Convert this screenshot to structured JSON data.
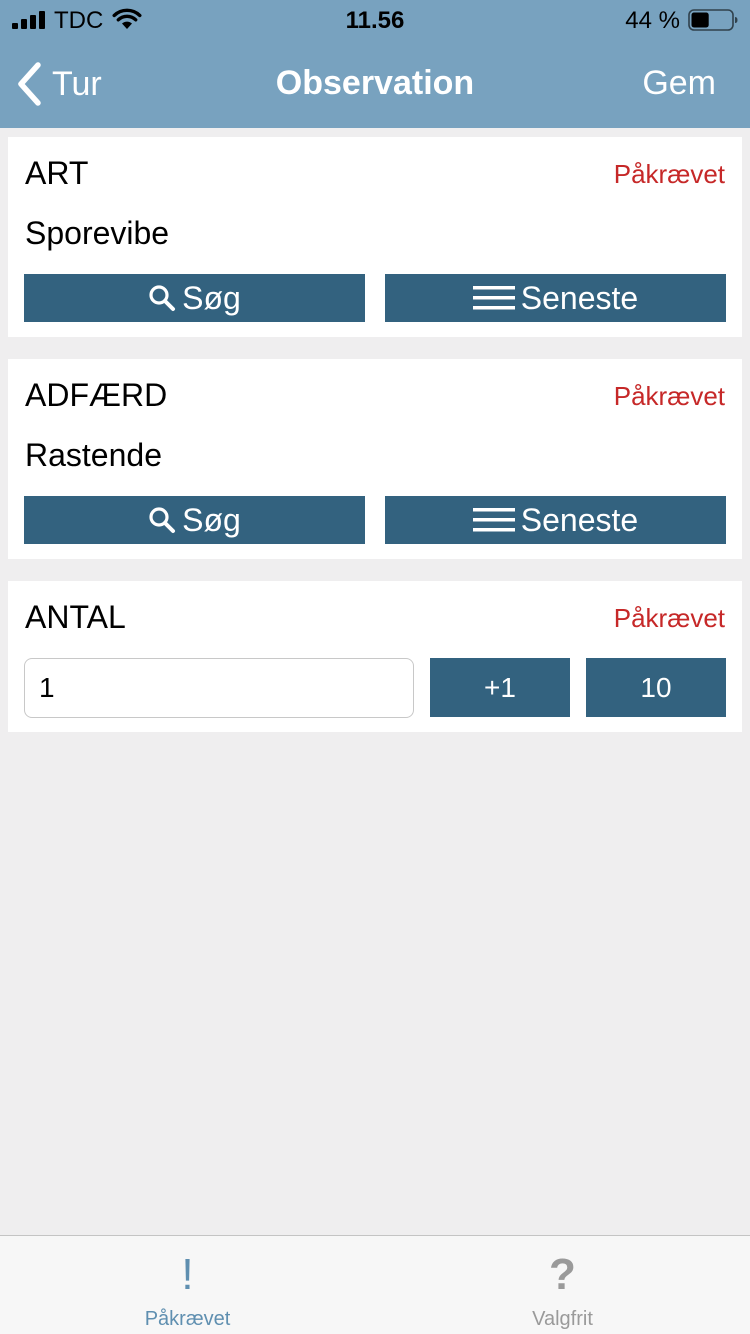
{
  "status_bar": {
    "carrier": "TDC",
    "time": "11.56",
    "battery_percent": "44 %",
    "battery_level": 0.44
  },
  "nav": {
    "back_label": "Tur",
    "title": "Observation",
    "save_label": "Gem"
  },
  "sections": {
    "art": {
      "label": "ART",
      "required": "Påkrævet",
      "value": "Sporevibe",
      "search_label": "Søg",
      "recent_label": "Seneste"
    },
    "adfaerd": {
      "label": "ADFÆRD",
      "required": "Påkrævet",
      "value": "Rastende",
      "search_label": "Søg",
      "recent_label": "Seneste"
    },
    "antal": {
      "label": "ANTAL",
      "required": "Påkrævet",
      "value": "1",
      "plus_one_label": "+1",
      "ten_label": "10"
    }
  },
  "tab_bar": {
    "tabs": [
      {
        "icon": "!",
        "label": "Påkrævet",
        "active": true
      },
      {
        "icon": "?",
        "label": "Valgfrit",
        "active": false
      }
    ]
  },
  "colors": {
    "header_bg": "#78a2bf",
    "button_bg": "#33627f",
    "required_text": "#c62828",
    "active_tab": "#5f8fb0",
    "page_bg": "#efeeef"
  }
}
